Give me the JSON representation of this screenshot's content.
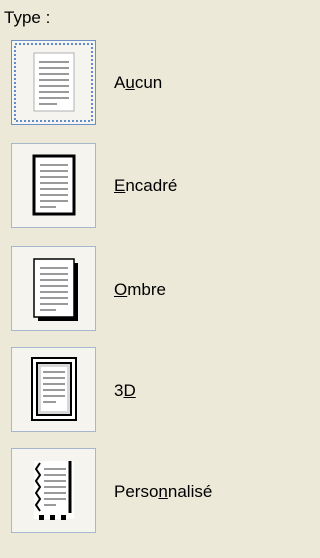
{
  "type_label": "Type :",
  "options": [
    {
      "id": "aucun",
      "pre": "A",
      "key": "u",
      "post": "cun",
      "selected": true,
      "icon": "page-no-border-icon"
    },
    {
      "id": "encadre",
      "pre": "",
      "key": "E",
      "post": "ncadré",
      "selected": false,
      "icon": "page-box-border-icon"
    },
    {
      "id": "ombre",
      "pre": "",
      "key": "O",
      "post": "mbre",
      "selected": false,
      "icon": "page-shadow-border-icon"
    },
    {
      "id": "3d",
      "pre": "3",
      "key": "D",
      "post": "",
      "selected": false,
      "icon": "page-3d-border-icon"
    },
    {
      "id": "personnalise",
      "pre": "Perso",
      "key": "n",
      "post": "nalisé",
      "selected": false,
      "icon": "page-custom-border-icon"
    }
  ],
  "colors": {
    "background": "#ece9d8",
    "button_border": "#a6b7cc",
    "selected_focus": "#316ac5"
  }
}
